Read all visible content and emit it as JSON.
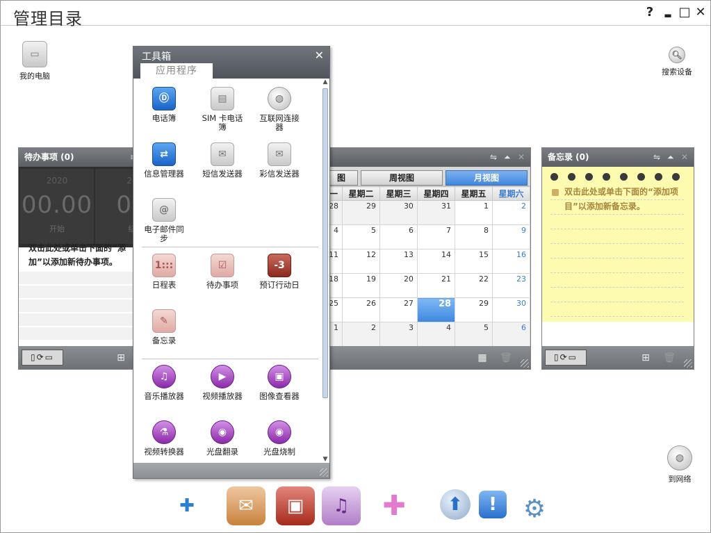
{
  "window": {
    "title": "管理目录",
    "help": "?",
    "minimize": "▁",
    "maximize": "□",
    "close": "✕"
  },
  "desktop": {
    "my_computer": "我的电脑",
    "search_device": "搜索设备",
    "to_network": "到网络"
  },
  "todo_panel": {
    "title": "待办事项 (0)",
    "start_date": "2020",
    "start_time": "00.00",
    "start_label": "开始",
    "end_date": "20",
    "end_time": "00",
    "end_label": "结",
    "hint": "双击此处或单击下面的“添加”以添加新待办事项。",
    "device_switch": "▯⟳▭",
    "add_icon": "add-task-icon"
  },
  "calendar_panel": {
    "views": [
      "图",
      "周视图",
      "月视图"
    ],
    "weekdays": [
      "一",
      "星期二",
      "星期三",
      "星期四",
      "星期五",
      "星期六"
    ],
    "weeks": [
      [
        "28",
        "29",
        "30",
        "31",
        "1",
        "2"
      ],
      [
        "4",
        "5",
        "6",
        "7",
        "8",
        "9"
      ],
      [
        "11",
        "12",
        "13",
        "14",
        "15",
        "16"
      ],
      [
        "18",
        "19",
        "20",
        "21",
        "22",
        "23"
      ],
      [
        "25",
        "26",
        "27",
        "28",
        "29",
        "30"
      ],
      [
        "1",
        "2",
        "3",
        "4",
        "5",
        "6"
      ]
    ],
    "today": "28"
  },
  "memo_panel": {
    "title": "备忘录 (0)",
    "hint": "双击此处或单击下面的“添加项目”以添加新备忘录。",
    "device_switch": "▯⟳▭"
  },
  "toolbox": {
    "title": "工具箱",
    "close": "✕",
    "tab": "应用程序",
    "apps": [
      {
        "label": "电话簿",
        "icon": "phonebook-icon"
      },
      {
        "label": "SIM 卡电话簿",
        "icon": "sim-phonebook-icon"
      },
      {
        "label": "互联网连接器",
        "icon": "internet-connector-icon"
      },
      {
        "label": "信息管理器",
        "icon": "message-manager-icon"
      },
      {
        "label": "短信发送器",
        "icon": "sms-sender-icon"
      },
      {
        "label": "彩信发送器",
        "icon": "mms-sender-icon"
      },
      {
        "label": "电子邮件同步",
        "icon": "email-sync-icon"
      },
      {
        "label": "日程表",
        "icon": "schedule-icon"
      },
      {
        "label": "待办事项",
        "icon": "todo-icon"
      },
      {
        "label": "预订行动日",
        "icon": "dday-icon"
      },
      {
        "label": "备忘录",
        "icon": "memo-icon"
      },
      {
        "label": "音乐播放器",
        "icon": "music-player-icon"
      },
      {
        "label": "视频播放器",
        "icon": "video-player-icon"
      },
      {
        "label": "图像查看器",
        "icon": "image-viewer-icon"
      },
      {
        "label": "视频转换器",
        "icon": "video-converter-icon"
      },
      {
        "label": "光盘翻录",
        "icon": "cd-rip-icon"
      },
      {
        "label": "光盘烧制",
        "icon": "cd-burn-icon"
      }
    ],
    "icon_glyphs": {
      "dday": "-3",
      "schedule": "1:::"
    }
  },
  "dock": [
    "puzzle-icon",
    "phone-mail-icon",
    "pda-icon",
    "media-icon",
    "plus-icon",
    "globe-upload-icon",
    "alert-icon",
    "gear-icon"
  ]
}
